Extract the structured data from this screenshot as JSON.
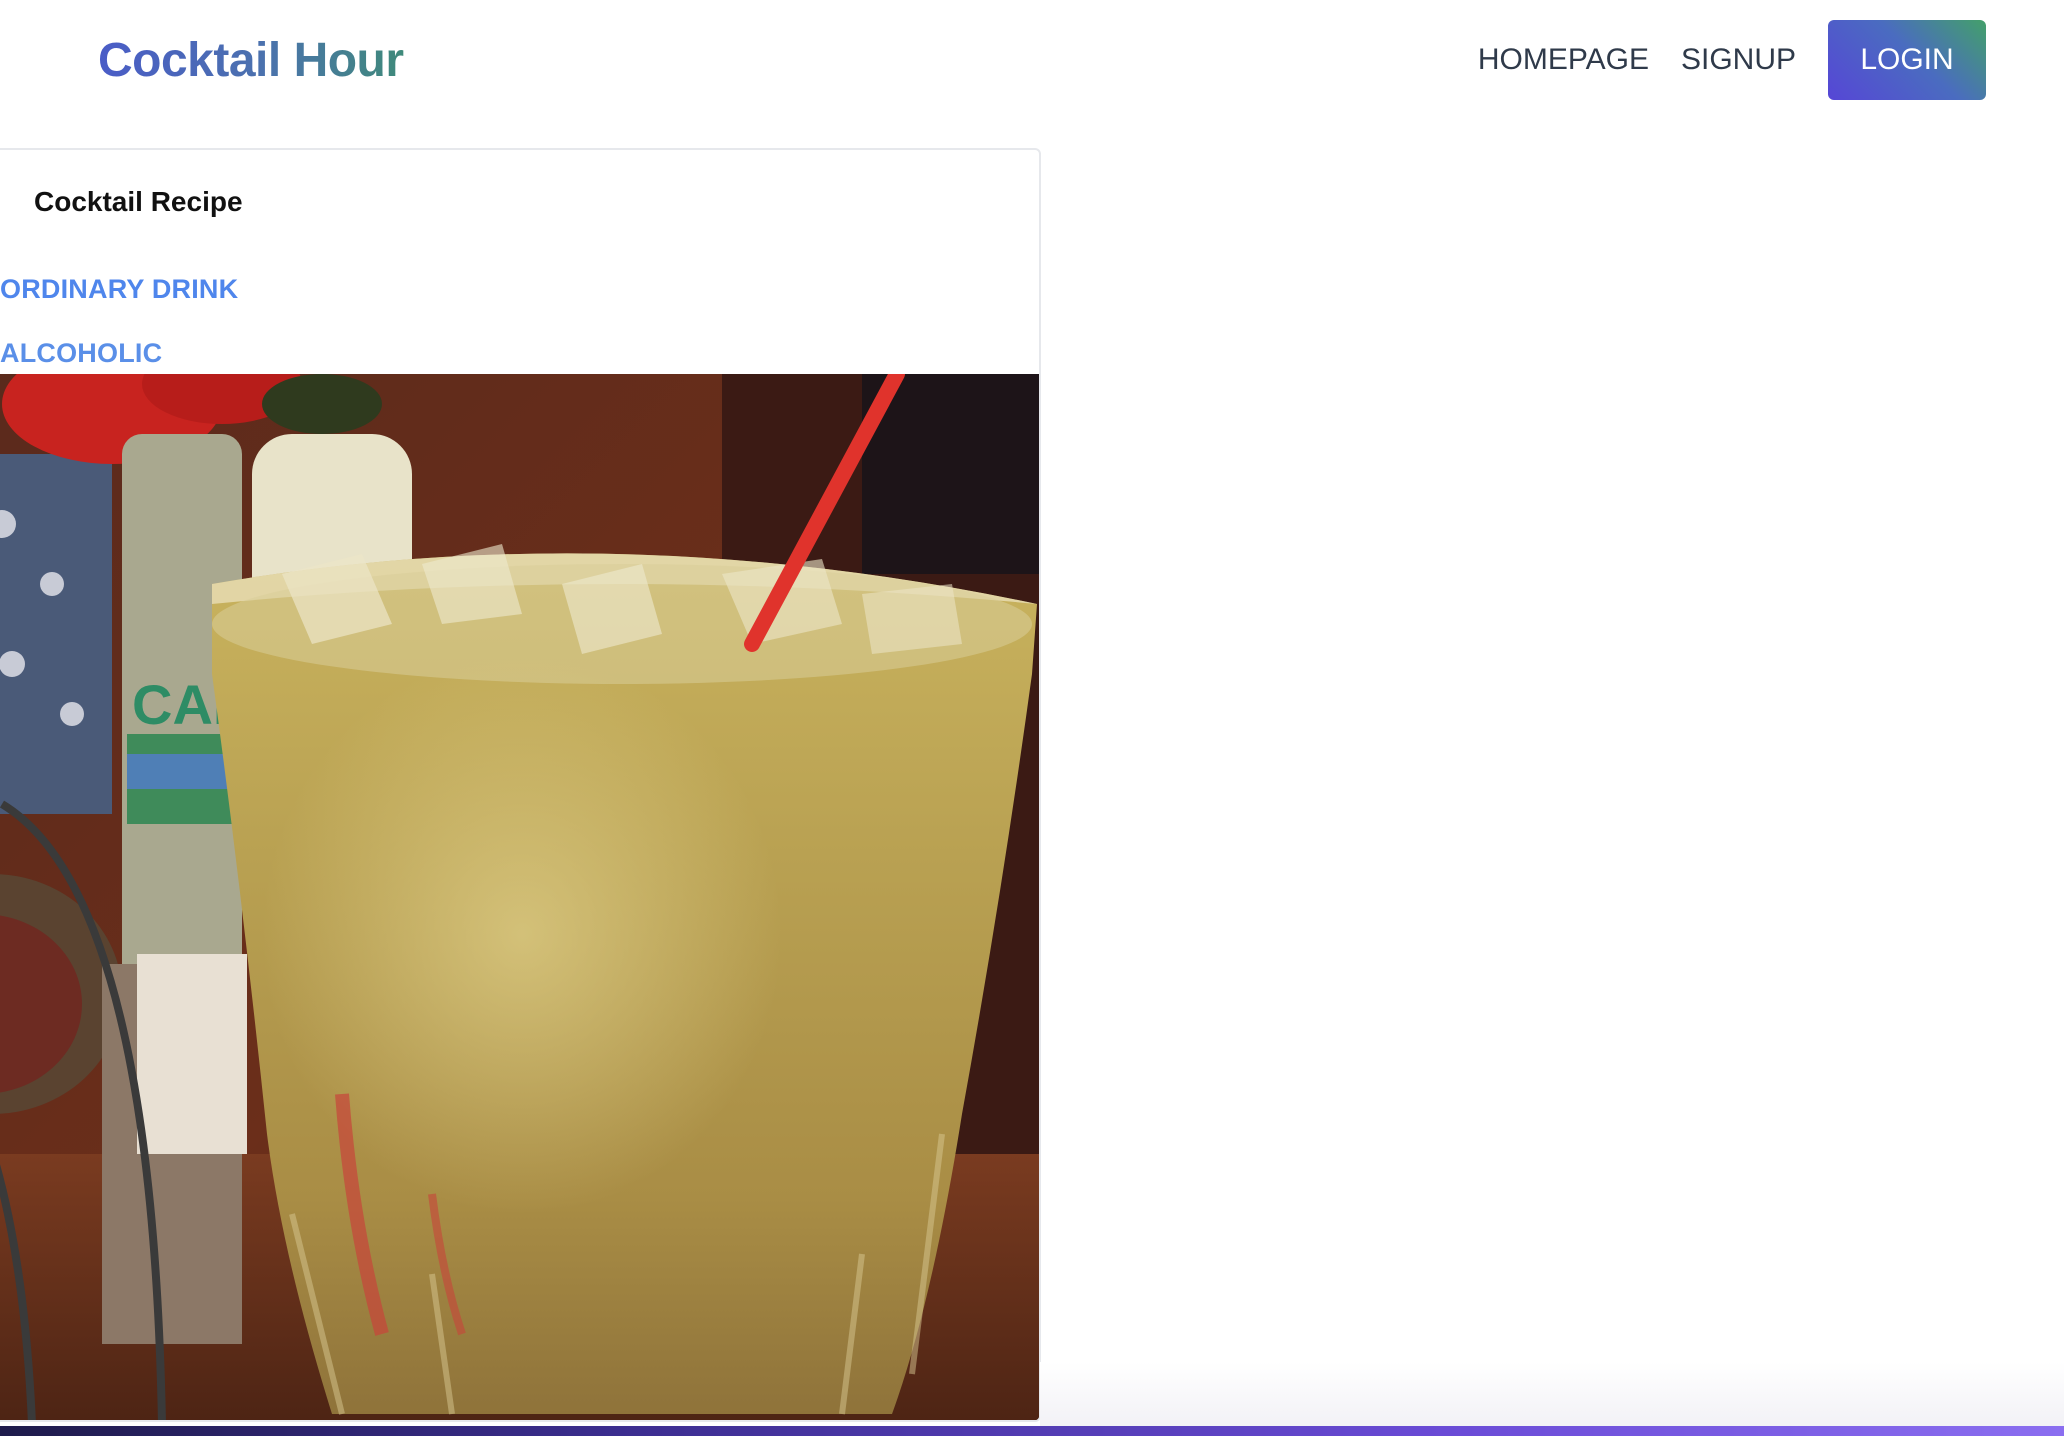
{
  "navbar": {
    "brand": "Cocktail Hour",
    "links": [
      "HOMEPAGE",
      "SIGNUP"
    ],
    "login_label": "LOGIN"
  },
  "card": {
    "title": "Cocktail Recipe",
    "category": "ORDINARY DRINK",
    "alcoholic": "ALCOHOLIC",
    "image_subject": "glass of pale yellow cocktail with ice and red straw"
  },
  "colors": {
    "brand_gradient_start": "#4a5cc7",
    "brand_gradient_end": "#3f8a7a",
    "tag_blue": "#4f86ec",
    "login_gradient_start": "#5646d6",
    "login_gradient_end": "#43a06a"
  }
}
